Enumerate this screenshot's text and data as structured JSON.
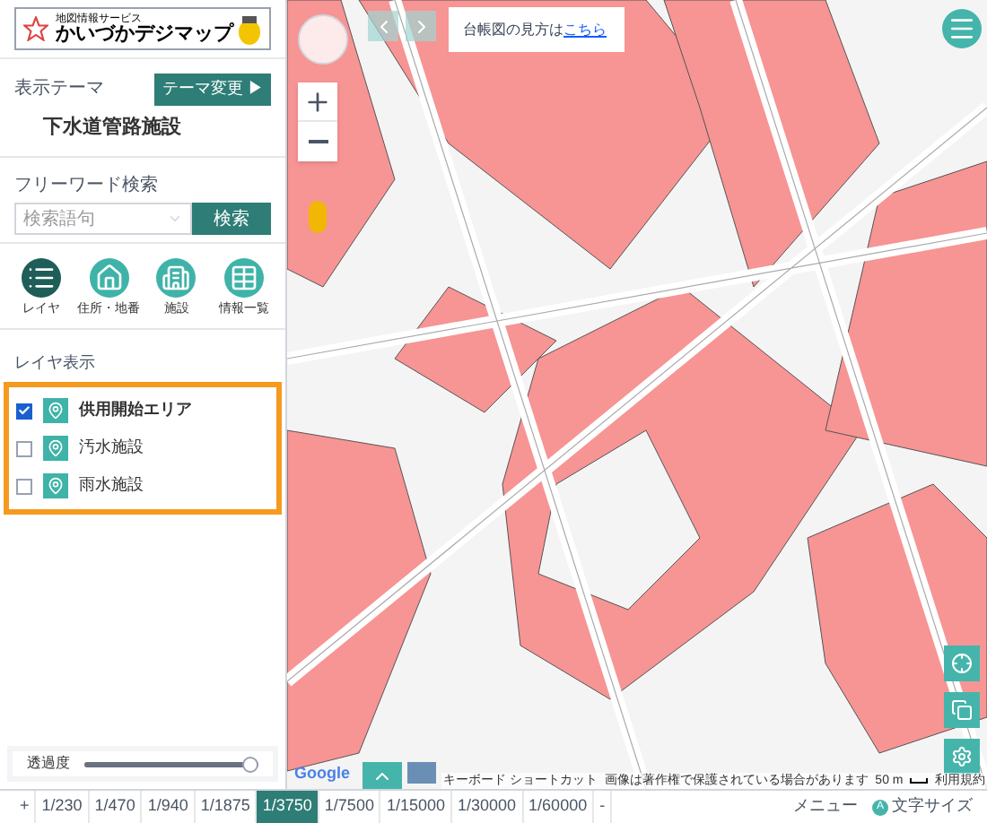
{
  "logo": {
    "service": "地図情報サービス",
    "title": "かいづかデジマップ"
  },
  "theme": {
    "label": "表示テーマ",
    "change_button": "テーマ変更 ▶",
    "name": "下水道管路施設"
  },
  "search": {
    "label": "フリーワード検索",
    "placeholder": "検索語句",
    "button": "検索"
  },
  "nav": [
    {
      "label": "レイヤ",
      "selected": true,
      "kind": "list"
    },
    {
      "label": "住所・地番",
      "selected": false,
      "kind": "home"
    },
    {
      "label": "施設",
      "selected": false,
      "kind": "building"
    },
    {
      "label": "情報一覧",
      "selected": false,
      "kind": "table"
    }
  ],
  "layers": {
    "label": "レイヤ表示",
    "items": [
      {
        "label": "供用開始エリア",
        "checked": true
      },
      {
        "label": "汚水施設",
        "checked": false
      },
      {
        "label": "雨水施設",
        "checked": false
      }
    ]
  },
  "opacity": {
    "label": "透過度",
    "level": 1
  },
  "map": {
    "notice": "台帳図の見方は",
    "notice_link": "こちら",
    "google": "Google",
    "shortcuts": "キーボード ショートカット",
    "copyright": "画像は著作権で保護されている場合があります",
    "scale": "50 m",
    "terms": "利用規約"
  },
  "scales": [
    {
      "label": "+",
      "selected": false
    },
    {
      "label": "1/230",
      "selected": false
    },
    {
      "label": "1/470",
      "selected": false
    },
    {
      "label": "1/940",
      "selected": false
    },
    {
      "label": "1/1875",
      "selected": false
    },
    {
      "label": "1/3750",
      "selected": true
    },
    {
      "label": "1/7500",
      "selected": false
    },
    {
      "label": "1/15000",
      "selected": false
    },
    {
      "label": "1/30000",
      "selected": false
    },
    {
      "label": "1/60000",
      "selected": false
    },
    {
      "label": "-",
      "selected": false
    }
  ],
  "footer": {
    "menu": "メニュー",
    "font_size": "文字サイズ",
    "font_icon": "A"
  }
}
